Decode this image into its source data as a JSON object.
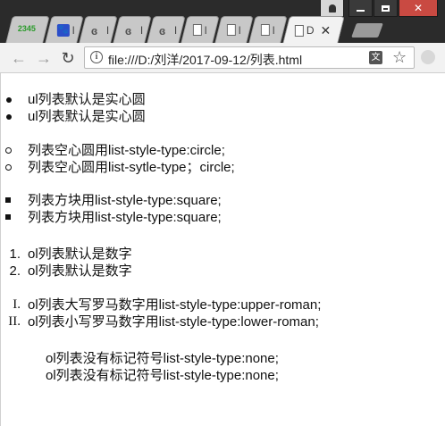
{
  "window": {
    "tabs": [
      {
        "icon": "2345-browser-icon",
        "letter": ""
      },
      {
        "icon": "baidu-paw-icon",
        "letter": "l"
      },
      {
        "icon": "e-script-icon",
        "letter": "I"
      },
      {
        "icon": "e-script-icon",
        "letter": "I"
      },
      {
        "icon": "e-script-icon",
        "letter": "I"
      },
      {
        "icon": "document-icon",
        "letter": "l"
      },
      {
        "icon": "document-icon",
        "letter": "l"
      },
      {
        "icon": "document-icon",
        "letter": "l"
      },
      {
        "icon": "document-icon",
        "letter": "D",
        "active": true,
        "close": "✕"
      }
    ],
    "controls": {
      "minimize": "—",
      "maximize": "▭",
      "close": "✕"
    }
  },
  "toolbar": {
    "back": "←",
    "forward": "→",
    "reload": "↻",
    "info": "i",
    "url": "file:///D:/刘洋/2017-09-12/列表.html",
    "translate": "文",
    "star": "☆"
  },
  "lists": {
    "disc": [
      "ul列表默认是实心圆",
      "ul列表默认是实心圆"
    ],
    "circle": [
      "列表空心圆用list-style-type:circle;",
      "列表空心圆用list-sytle-type；circle;"
    ],
    "square": [
      "列表方块用list-style-type:square;",
      "列表方块用list-style-type:square;"
    ],
    "decimal": {
      "markers": [
        "1.",
        "2."
      ],
      "items": [
        "ol列表默认是数字",
        "ol列表默认是数字"
      ]
    },
    "roman": {
      "markers": [
        "I.",
        "II."
      ],
      "items": [
        "ol列表大写罗马数字用list-style-type:upper-roman;",
        "ol列表小写罗马数字用list-style-type:lower-roman;"
      ]
    },
    "none": [
      "ol列表没有标记符号list-style-type:none;",
      "ol列表没有标记符号list-style-type:none;"
    ]
  }
}
